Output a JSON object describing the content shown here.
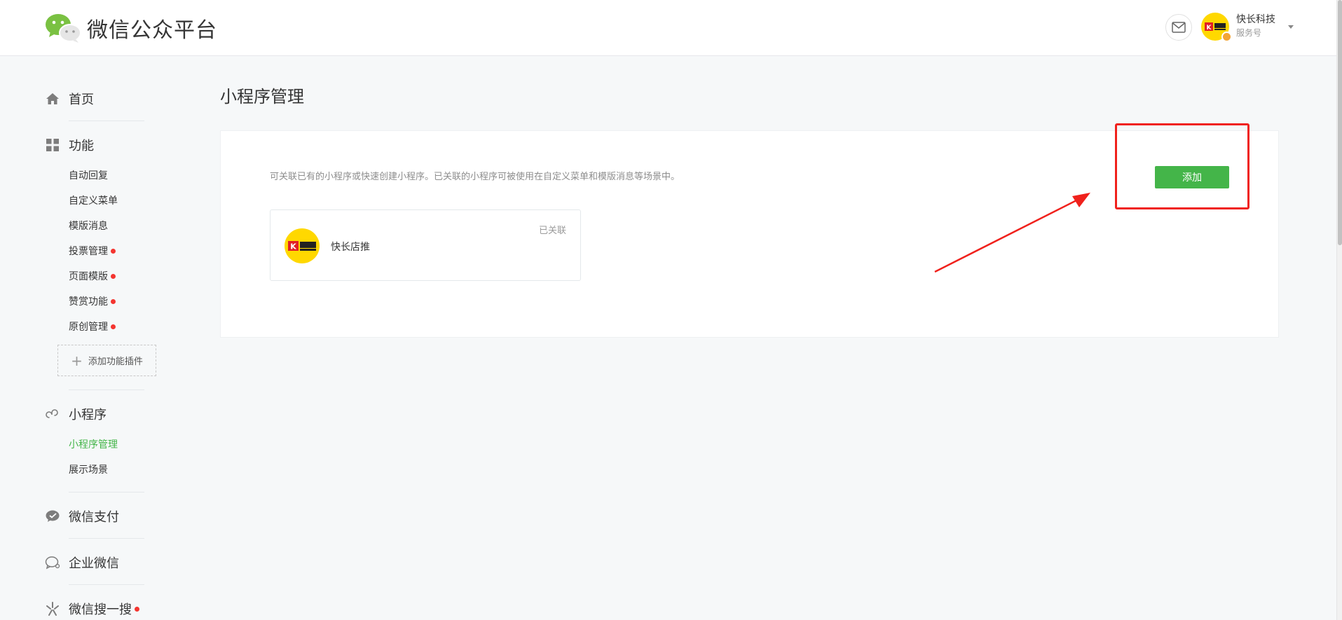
{
  "header": {
    "logo_text": "微信公众平台",
    "account_name": "快长科技",
    "account_type": "服务号"
  },
  "sidebar": {
    "home": "首页",
    "features": {
      "label": "功能",
      "items": [
        {
          "label": "自动回复",
          "dot": false
        },
        {
          "label": "自定义菜单",
          "dot": false
        },
        {
          "label": "模版消息",
          "dot": false
        },
        {
          "label": "投票管理",
          "dot": true
        },
        {
          "label": "页面模版",
          "dot": true
        },
        {
          "label": "赞赏功能",
          "dot": true
        },
        {
          "label": "原创管理",
          "dot": true
        }
      ],
      "add_plugin": "添加功能插件"
    },
    "miniprogram": {
      "label": "小程序",
      "items": [
        {
          "label": "小程序管理",
          "active": true
        },
        {
          "label": "展示场景",
          "active": false
        }
      ]
    },
    "wechat_pay": "微信支付",
    "work_wechat": "企业微信",
    "wechat_search": "微信搜一搜"
  },
  "main": {
    "title": "小程序管理",
    "description": "可关联已有的小程序或快速创建小程序。已关联的小程序可被使用在自定义菜单和模版消息等场景中。",
    "add_button": "添加",
    "miniprograms": [
      {
        "name": "快长店推",
        "status": "已关联"
      }
    ]
  },
  "colors": {
    "accent_green": "#44b549",
    "annotation_red": "#f0211c",
    "badge_red": "#f43530"
  }
}
